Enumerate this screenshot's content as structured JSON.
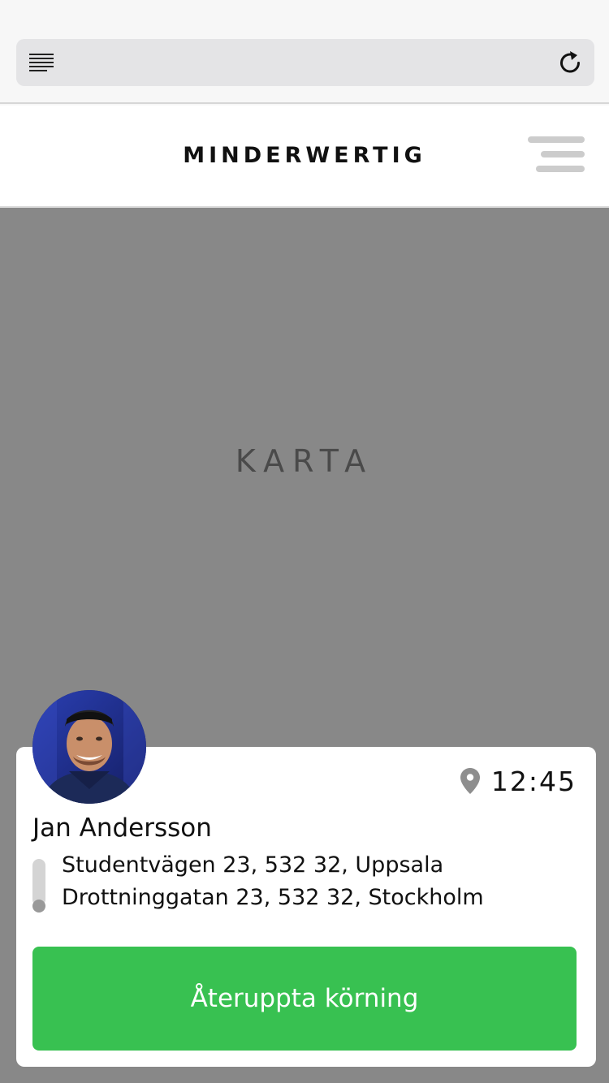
{
  "browser": {
    "icons": {
      "reader": "reader-mode-icon",
      "reload": "reload-icon"
    }
  },
  "header": {
    "brand": "MINDERWERTIG",
    "menu_icon": "hamburger-menu-icon"
  },
  "map": {
    "placeholder": "KARTA"
  },
  "trip": {
    "eta_icon": "map-pin-icon",
    "eta_time": "12:45",
    "passenger_name": "Jan Andersson",
    "from_address": "Studentvägen 23, 532 32, Uppsala",
    "to_address": "Drottninggatan 23, 532 32, Stockholm",
    "resume_label": "Återuppta körning"
  },
  "colors": {
    "map_background": "#888888",
    "button_green": "#38c151",
    "menu_grey": "#cccccc",
    "route_track": "#d4d4d4",
    "route_dot": "#999999"
  }
}
